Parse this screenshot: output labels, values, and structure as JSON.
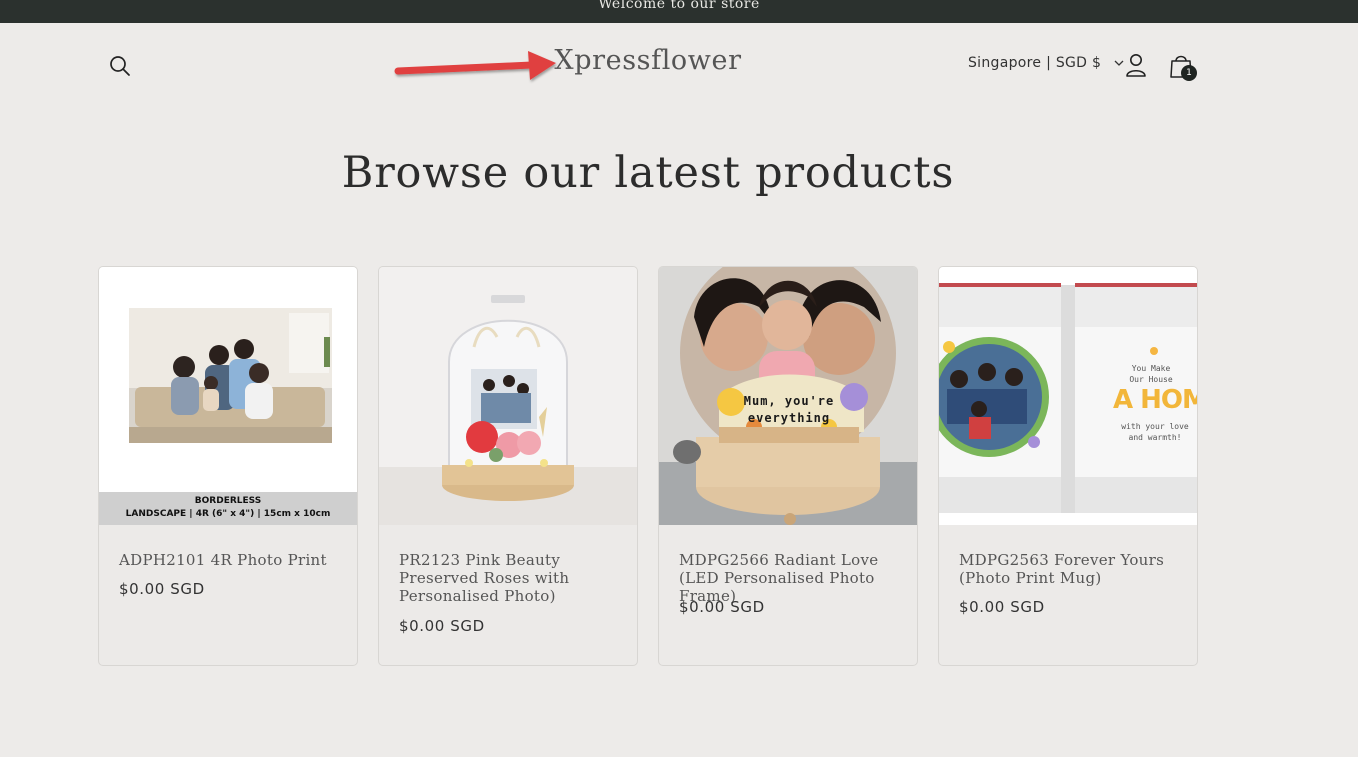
{
  "announcement": {
    "text": "Welcome to our store"
  },
  "header": {
    "logo": "Xpressflower",
    "locale": "Singapore | SGD $",
    "cart_count": "1",
    "icons": {
      "search": "search-icon",
      "account": "account-icon",
      "cart": "cart-icon",
      "locale_dropdown": "chevron-down-icon",
      "annotation": "arrow-annotation"
    }
  },
  "section": {
    "title": "Browse our latest products"
  },
  "products": [
    {
      "title": "ADPH2101 4R Photo Print",
      "price": "$0.00 SGD",
      "caption_line1": "BORDERLESS",
      "caption_line2": "LANDSCAPE | 4R (6\" x 4\") | 15cm x 10cm"
    },
    {
      "title": "PR2123 Pink Beauty Preserved Roses with Personalised Photo)",
      "price": "$0.00 SGD"
    },
    {
      "title": "MDPG2566 Radiant Love (LED Personalised Photo Frame)",
      "price": "$0.00 SGD",
      "frame_text": "Mum, you're everything"
    },
    {
      "title": "MDPG2563 Forever Yours (Photo Print Mug)",
      "price": "$0.00 SGD",
      "mug_text_1": "You Make",
      "mug_text_2": "Our House",
      "mug_text_3": "A HOME",
      "mug_text_4": "with your love",
      "mug_text_5": "and warmth!"
    }
  ],
  "colors": {
    "background": "#edebe9",
    "announcement_bg": "#2b312e",
    "arrow": "#e0403f"
  }
}
